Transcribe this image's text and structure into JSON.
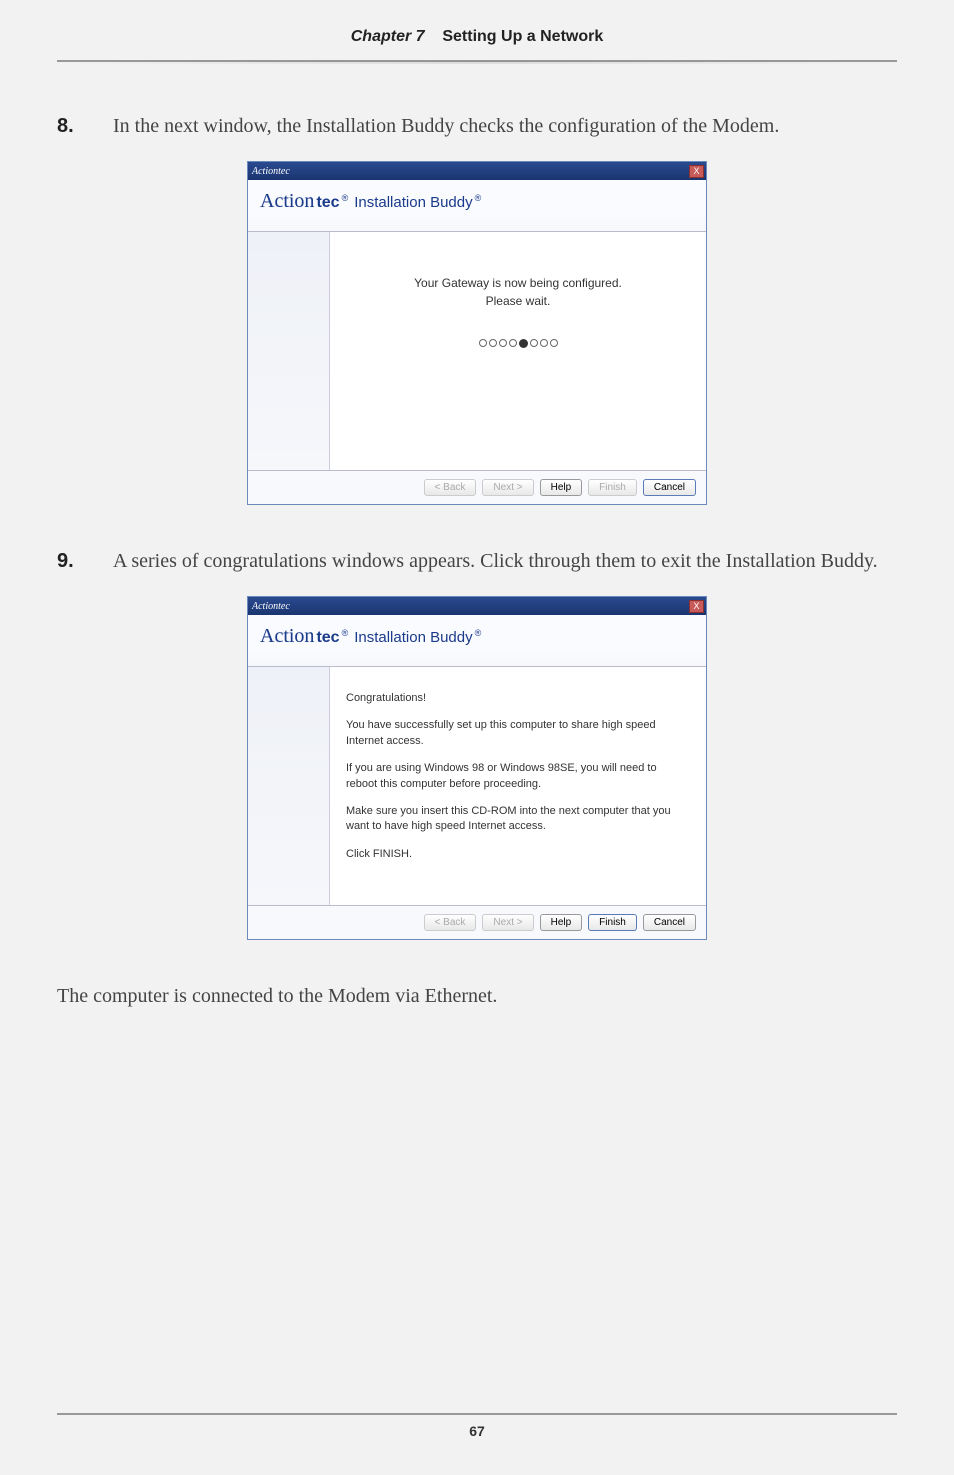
{
  "header": {
    "chapter_label": "Chapter 7",
    "chapter_title": "Setting Up a Network"
  },
  "steps": {
    "s8": {
      "num": "8.",
      "text": "In the next window, the Installation Buddy checks the configuration of the Modem."
    },
    "s9": {
      "num": "9.",
      "text": "A series of congratulations windows appears. Click through them to exit the Installation Buddy."
    }
  },
  "wizard1": {
    "titlebar": "Actiontec",
    "close": "X",
    "brand_script": "Action",
    "brand_bold": "tec",
    "brand_reg": "®",
    "brand_sub": "Installation Buddy",
    "msg_line1": "Your Gateway is now being configured.",
    "msg_line2": "Please wait.",
    "buttons": {
      "back": "< Back",
      "next": "Next >",
      "help": "Help",
      "finish": "Finish",
      "cancel": "Cancel"
    }
  },
  "wizard2": {
    "titlebar": "Actiontec",
    "close": "X",
    "brand_script": "Action",
    "brand_bold": "tec",
    "brand_reg": "®",
    "brand_sub": "Installation Buddy",
    "p1": "Congratulations!",
    "p2": "You have successfully set up this computer to share high speed Internet access.",
    "p3": "If you are using Windows 98 or Windows 98SE, you will need to reboot this computer before proceeding.",
    "p4": "Make sure you insert this CD-ROM into the next computer that you want to have high speed Internet access.",
    "p5": "Click FINISH.",
    "buttons": {
      "back": "< Back",
      "next": "Next >",
      "help": "Help",
      "finish": "Finish",
      "cancel": "Cancel"
    }
  },
  "final_line": "The computer is connected to the Modem via Ethernet.",
  "page_number": "67"
}
